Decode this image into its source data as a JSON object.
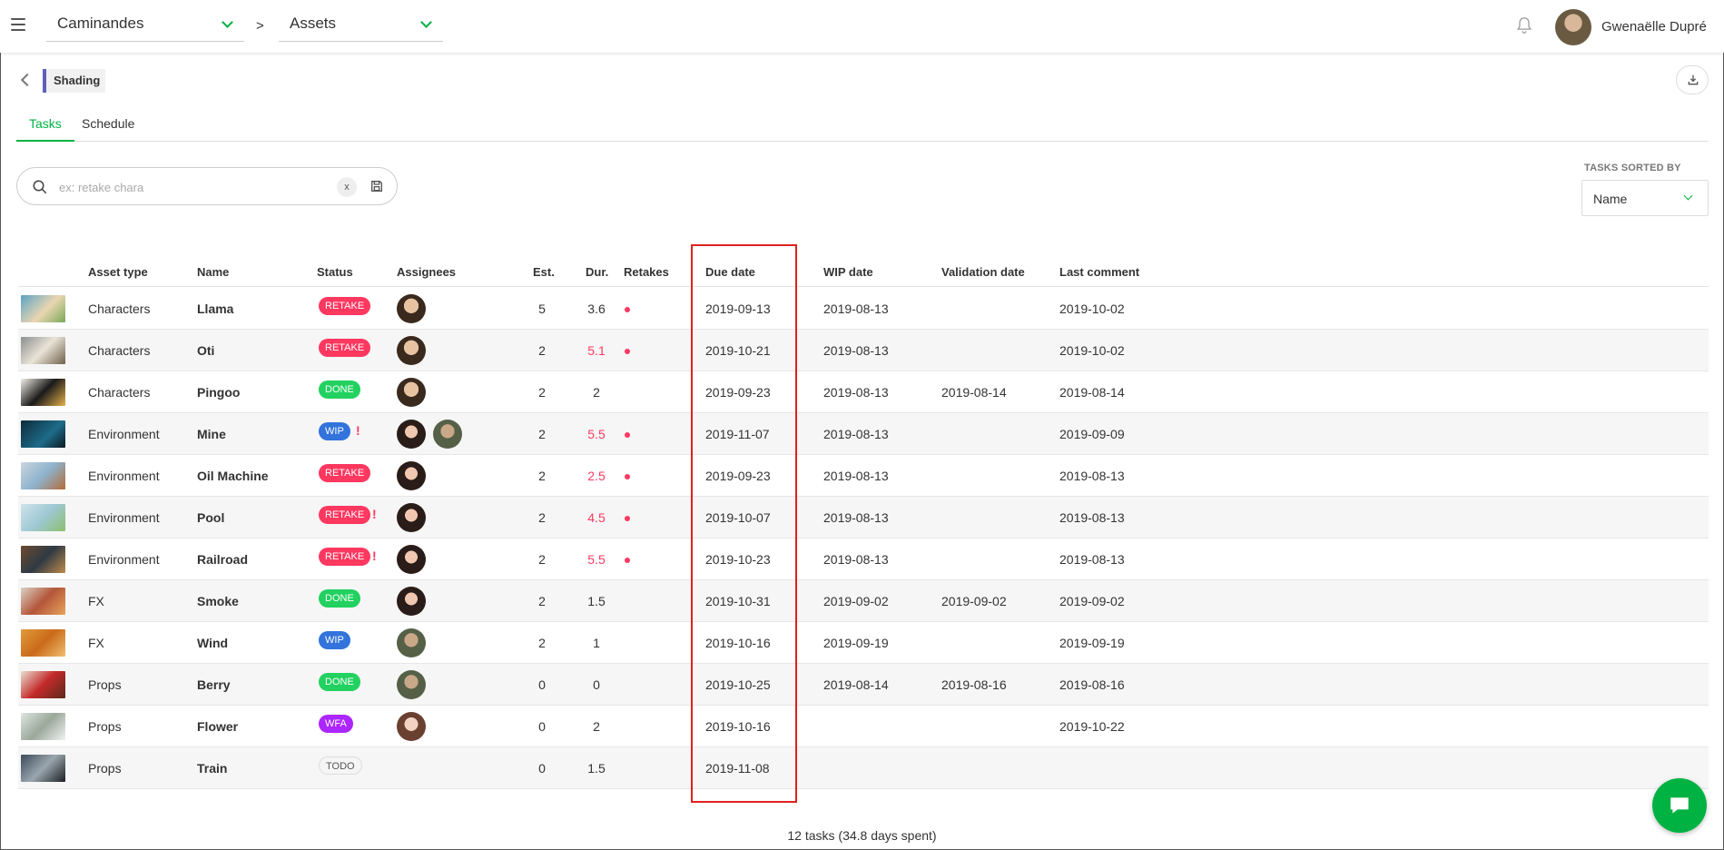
{
  "topbar": {
    "production": "Caminandes",
    "separator": ">",
    "section": "Assets",
    "user_name": "Gwenaëlle Dupré"
  },
  "page": {
    "title": "Shading",
    "tabs": [
      {
        "label": "Tasks",
        "active": true
      },
      {
        "label": "Schedule",
        "active": false
      }
    ]
  },
  "search": {
    "placeholder": "ex: retake chara",
    "clear_label": "x",
    "value": ""
  },
  "sort": {
    "label": "TASKS SORTED BY",
    "value": "Name"
  },
  "table": {
    "headers": {
      "asset_type": "Asset type",
      "name": "Name",
      "status": "Status",
      "assignees": "Assignees",
      "est": "Est.",
      "dur": "Dur.",
      "retakes": "Retakes",
      "due_date": "Due date",
      "wip_date": "WIP date",
      "validation_date": "Validation date",
      "last_comment": "Last comment"
    },
    "rows": [
      {
        "asset_type": "Characters",
        "name": "Llama",
        "status": "RETAKE",
        "warning": false,
        "assignees": [
          "man"
        ],
        "est": "5",
        "dur": "3.6",
        "dur_over": false,
        "retake": true,
        "due": "2019-09-13",
        "wip": "2019-08-13",
        "validation": "",
        "last_comment": "2019-10-02"
      },
      {
        "asset_type": "Characters",
        "name": "Oti",
        "status": "RETAKE",
        "warning": false,
        "assignees": [
          "man"
        ],
        "est": "2",
        "dur": "5.1",
        "dur_over": true,
        "retake": true,
        "due": "2019-10-21",
        "wip": "2019-08-13",
        "validation": "",
        "last_comment": "2019-10-02"
      },
      {
        "asset_type": "Characters",
        "name": "Pingoo",
        "status": "DONE",
        "warning": false,
        "assignees": [
          "man"
        ],
        "est": "2",
        "dur": "2",
        "dur_over": false,
        "retake": false,
        "due": "2019-09-23",
        "wip": "2019-08-13",
        "validation": "2019-08-14",
        "last_comment": "2019-08-14"
      },
      {
        "asset_type": "Environment",
        "name": "Mine",
        "status": "WIP",
        "warning": true,
        "assignees": [
          "woman",
          "man2"
        ],
        "est": "2",
        "dur": "5.5",
        "dur_over": true,
        "retake": true,
        "due": "2019-11-07",
        "wip": "2019-08-13",
        "validation": "",
        "last_comment": "2019-09-09"
      },
      {
        "asset_type": "Environment",
        "name": "Oil Machine",
        "status": "RETAKE",
        "warning": false,
        "assignees": [
          "woman"
        ],
        "est": "2",
        "dur": "2.5",
        "dur_over": true,
        "retake": true,
        "due": "2019-09-23",
        "wip": "2019-08-13",
        "validation": "",
        "last_comment": "2019-08-13"
      },
      {
        "asset_type": "Environment",
        "name": "Pool",
        "status": "RETAKE",
        "warning": true,
        "assignees": [
          "woman"
        ],
        "est": "2",
        "dur": "4.5",
        "dur_over": true,
        "retake": true,
        "due": "2019-10-07",
        "wip": "2019-08-13",
        "validation": "",
        "last_comment": "2019-08-13"
      },
      {
        "asset_type": "Environment",
        "name": "Railroad",
        "status": "RETAKE",
        "warning": true,
        "assignees": [
          "woman"
        ],
        "est": "2",
        "dur": "5.5",
        "dur_over": true,
        "retake": true,
        "due": "2019-10-23",
        "wip": "2019-08-13",
        "validation": "",
        "last_comment": "2019-08-13"
      },
      {
        "asset_type": "FX",
        "name": "Smoke",
        "status": "DONE",
        "warning": false,
        "assignees": [
          "woman"
        ],
        "est": "2",
        "dur": "1.5",
        "dur_over": false,
        "retake": false,
        "due": "2019-10-31",
        "wip": "2019-09-02",
        "validation": "2019-09-02",
        "last_comment": "2019-09-02"
      },
      {
        "asset_type": "FX",
        "name": "Wind",
        "status": "WIP",
        "warning": false,
        "assignees": [
          "man2"
        ],
        "est": "2",
        "dur": "1",
        "dur_over": false,
        "retake": false,
        "due": "2019-10-16",
        "wip": "2019-09-19",
        "validation": "",
        "last_comment": "2019-09-19"
      },
      {
        "asset_type": "Props",
        "name": "Berry",
        "status": "DONE",
        "warning": false,
        "assignees": [
          "man2"
        ],
        "est": "0",
        "dur": "0",
        "dur_over": false,
        "retake": false,
        "due": "2019-10-25",
        "wip": "2019-08-14",
        "validation": "2019-08-16",
        "last_comment": "2019-08-16"
      },
      {
        "asset_type": "Props",
        "name": "Flower",
        "status": "WFA",
        "warning": false,
        "assignees": [
          "woman2"
        ],
        "est": "0",
        "dur": "2",
        "dur_over": false,
        "retake": false,
        "due": "2019-10-16",
        "wip": "",
        "validation": "",
        "last_comment": "2019-10-22"
      },
      {
        "asset_type": "Props",
        "name": "Train",
        "status": "TODO",
        "warning": false,
        "assignees": [],
        "est": "0",
        "dur": "1.5",
        "dur_over": false,
        "retake": false,
        "due": "2019-11-08",
        "wip": "",
        "validation": "",
        "last_comment": ""
      }
    ]
  },
  "footer": {
    "summary": "12 tasks (34.8 days spent)"
  },
  "colors": {
    "accent": "#00b242",
    "retake": "#ff3860",
    "done": "#22d160",
    "wip": "#3273dc",
    "wfa": "#ab26ff",
    "todo": "#f5f5f5",
    "highlight": "#e02020"
  }
}
